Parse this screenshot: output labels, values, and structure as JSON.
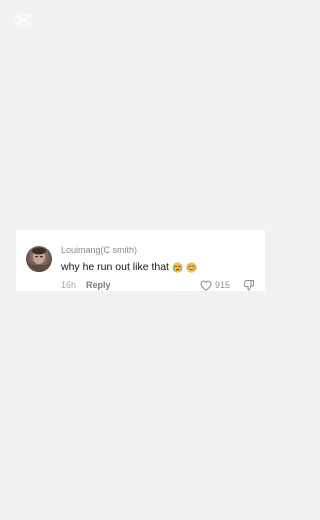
{
  "comment": {
    "username": "Louimang(C smith)",
    "text": "why he run out like that",
    "emojis": [
      "crying-face",
      "tears-of-joy-face"
    ],
    "timestamp": "16h",
    "reply_label": "Reply",
    "like_count": "915"
  },
  "icons": {
    "like": "heart-icon",
    "dislike": "dislike-icon",
    "watermark": "capcut-logo-icon"
  },
  "colors": {
    "background": "#f1f0f2",
    "card": "#ffffff",
    "username": "#8a8a8a",
    "text": "#161616"
  }
}
